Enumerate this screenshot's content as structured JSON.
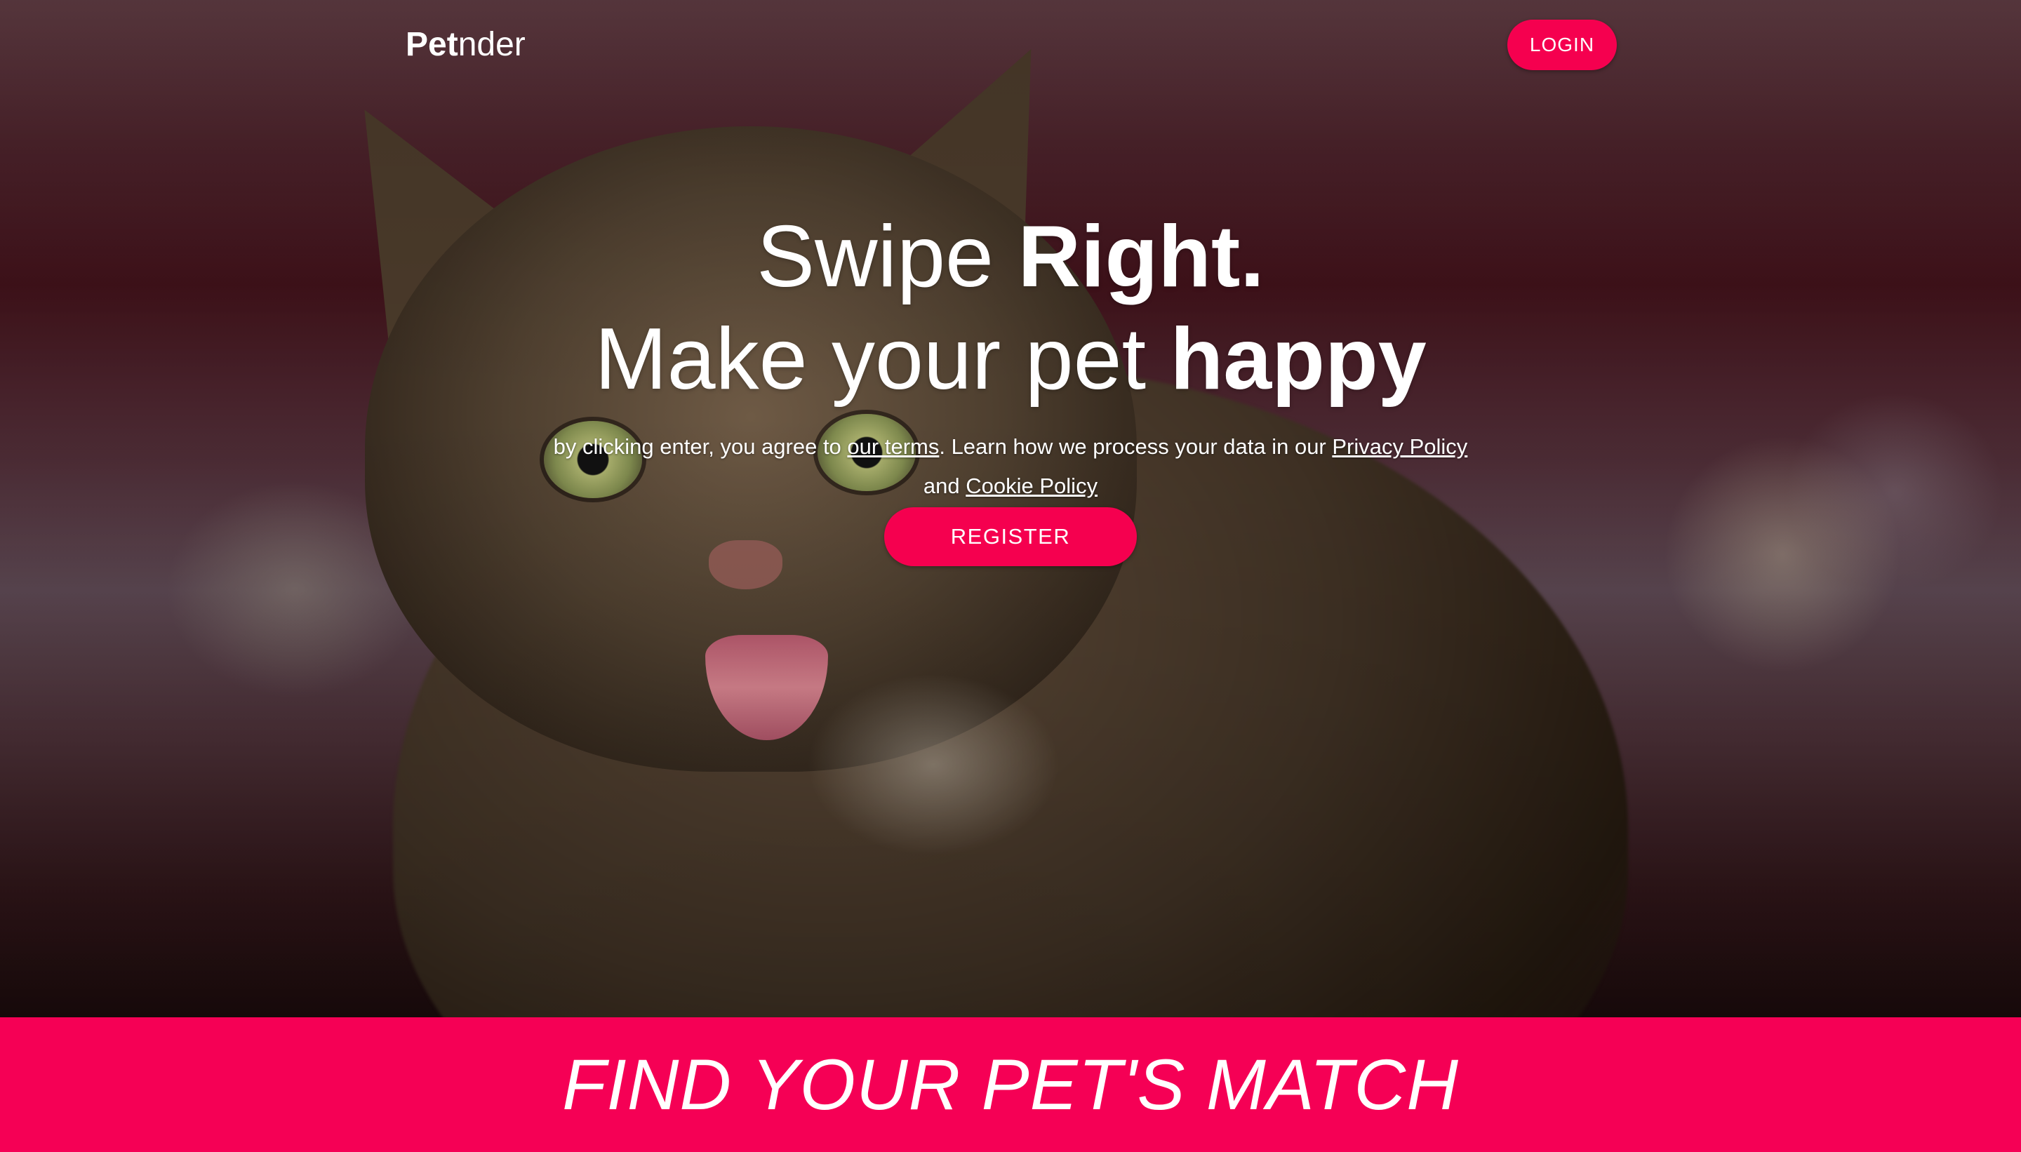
{
  "nav": {
    "brand_strong": "Pet",
    "brand_light": "nder",
    "login_label": "LOGIN"
  },
  "hero": {
    "line1_light": "Swipe ",
    "line1_bold": "Right.",
    "line2_light": "Make your pet ",
    "line2_bold": "happy",
    "legal_prefix": "by clicking enter, you agree to ",
    "terms_link": "our terms",
    "legal_middle": ". Learn how we process your data in our ",
    "privacy_link": "Privacy Policy",
    "legal_and": " and ",
    "cookie_link": "Cookie Policy",
    "register_label": "REGISTER"
  },
  "banner": {
    "text": "FIND YOUR PET'S MATCH"
  },
  "colors": {
    "accent": "#f5004f",
    "banner": "#f50055",
    "text": "#ffffff"
  },
  "background": {
    "subject": "tabby cat with tongue out, blurred maroon background"
  }
}
